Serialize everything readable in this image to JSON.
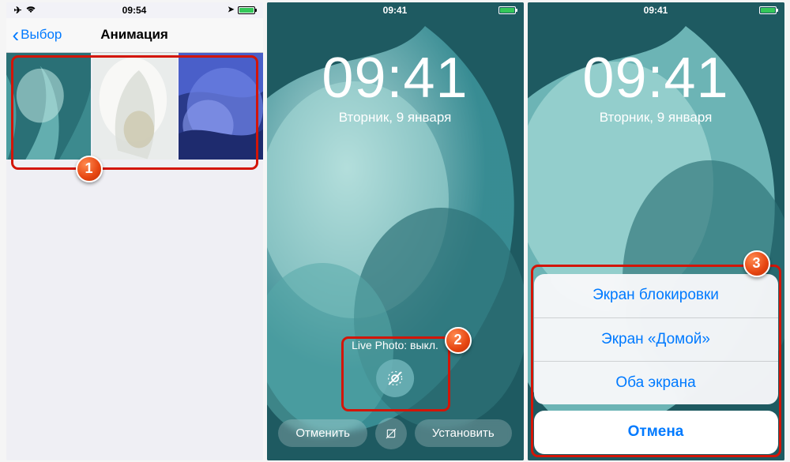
{
  "screen1": {
    "status": {
      "time": "09:54",
      "airplane": "✈",
      "wifi": "wifi",
      "loc": "➤",
      "charging": true
    },
    "nav": {
      "back_chevron": "‹",
      "back_label": "Выбор",
      "title": "Анимация"
    },
    "thumbs": [
      "wallpaper-teal",
      "wallpaper-white",
      "wallpaper-blue"
    ]
  },
  "screen2": {
    "status": {
      "time": "09:41"
    },
    "lock": {
      "time": "09:41",
      "date": "Вторник, 9 января"
    },
    "live_photo_label": "Live Photo: выкл.",
    "buttons": {
      "cancel": "Отменить",
      "set": "Установить"
    }
  },
  "screen3": {
    "status": {
      "time": "09:41"
    },
    "lock": {
      "time": "09:41",
      "date": "Вторник, 9 января"
    },
    "sheet": {
      "options": [
        "Экран блокировки",
        "Экран «Домой»",
        "Оба экрана"
      ],
      "cancel": "Отмена"
    }
  },
  "badges": {
    "b1": "1",
    "b2": "2",
    "b3": "3"
  }
}
